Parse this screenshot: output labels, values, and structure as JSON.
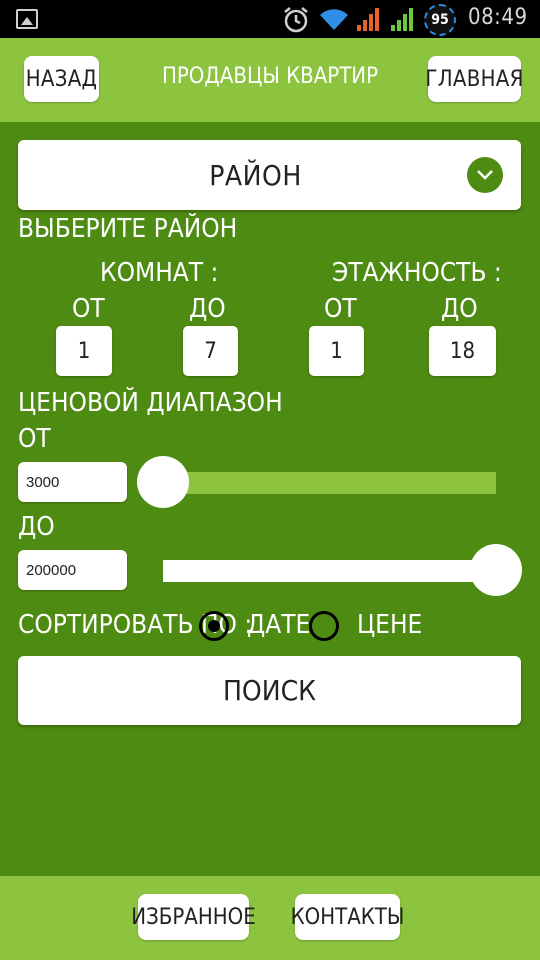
{
  "status_bar": {
    "battery_level": "95",
    "time": "08:49",
    "icons": [
      "image-icon",
      "alarm-icon",
      "wifi-icon",
      "signal-icon",
      "signal-icon",
      "battery-icon"
    ]
  },
  "header": {
    "back_label": "НАЗАД",
    "title": "ПРОДАВЦЫ КВАРТИР",
    "home_label": "ГЛАВНАЯ"
  },
  "district": {
    "dropdown_label": "РАЙОН",
    "hint": "ВЫБЕРИТЕ РАЙОН"
  },
  "rooms": {
    "label": "КОМНАТ :",
    "from_label": "ОТ",
    "to_label": "ДО",
    "from_value": "1",
    "to_value": "7"
  },
  "floors": {
    "label": "ЭТАЖНОСТЬ :",
    "from_label": "ОТ",
    "to_label": "ДО",
    "from_value": "1",
    "to_value": "18"
  },
  "price": {
    "label": "ЦЕНОВОЙ ДИАПАЗОН",
    "from_label": "ОТ",
    "from_value": "3000",
    "from_slider_level": 0,
    "to_label": "ДО",
    "to_value": "200000",
    "to_slider_level": 1
  },
  "sort": {
    "label": "СОРТИРОВАТЬ ПО :",
    "options": [
      {
        "label": "ДАТЕ",
        "selected": true
      },
      {
        "label": "ЦЕНЕ",
        "selected": false
      }
    ]
  },
  "search_label": "ПОИСК",
  "footer": {
    "favorites_label": "ИЗБРАННОЕ",
    "contacts_label": "КОНТАКТЫ"
  },
  "colors": {
    "background": "#4e8b12",
    "bar": "#8cc43f",
    "white": "#ffffff"
  }
}
